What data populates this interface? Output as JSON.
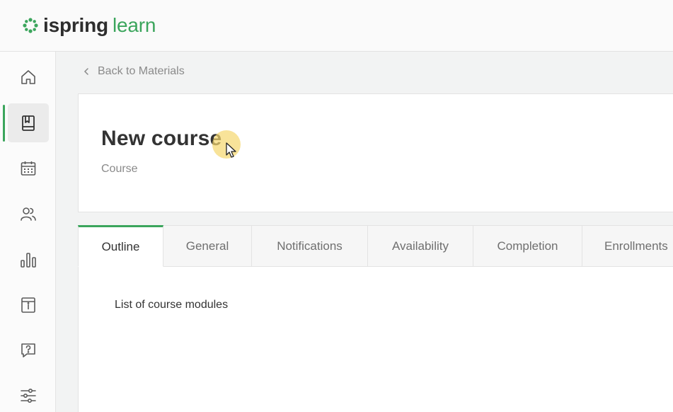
{
  "app": {
    "logo_part1": "ispring",
    "logo_part2": "learn",
    "accent_color": "#3ba55c"
  },
  "sidebar": {
    "items": [
      {
        "icon": "home-icon",
        "active": false
      },
      {
        "icon": "book-icon",
        "active": true
      },
      {
        "icon": "calendar-icon",
        "active": false
      },
      {
        "icon": "users-icon",
        "active": false
      },
      {
        "icon": "chart-icon",
        "active": false
      },
      {
        "icon": "info-icon",
        "active": false
      },
      {
        "icon": "help-icon",
        "active": false
      },
      {
        "icon": "settings-sliders-icon",
        "active": false
      }
    ]
  },
  "breadcrumb": {
    "back_label": "Back to Materials"
  },
  "course": {
    "title": "New course",
    "type": "Course"
  },
  "tabs": [
    {
      "label": "Outline",
      "active": true
    },
    {
      "label": "General",
      "active": false
    },
    {
      "label": "Notifications",
      "active": false
    },
    {
      "label": "Availability",
      "active": false
    },
    {
      "label": "Completion",
      "active": false
    },
    {
      "label": "Enrollments",
      "active": false
    }
  ],
  "outline": {
    "modules_label": "List of course modules"
  }
}
